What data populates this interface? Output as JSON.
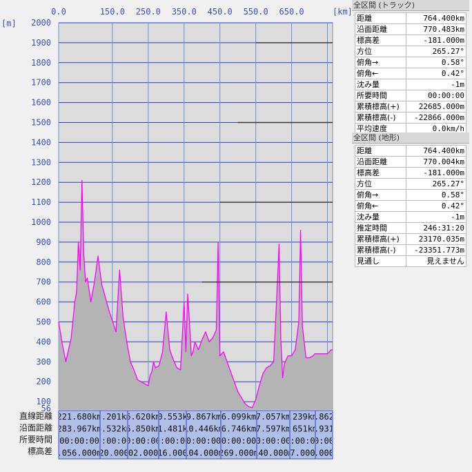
{
  "chart_data": {
    "type": "area",
    "xlabel": "",
    "ylabel": "",
    "x_unit": "[km]",
    "y_unit": "[m]",
    "x_ticks": [
      "0.0",
      "150.0",
      "250.0",
      "350.0",
      "450.0",
      "550.0",
      "650.0"
    ],
    "y_ticks": [
      "2000",
      "1900",
      "1800",
      "1700",
      "1600",
      "1500",
      "1400",
      "1300",
      "1200",
      "1100",
      "1000",
      "900",
      "800",
      "700",
      "600",
      "500",
      "400",
      "300",
      "200",
      "100",
      "56"
    ],
    "xlim": [
      0,
      764.4
    ],
    "ylim": [
      56,
      2000
    ],
    "series": [
      {
        "x": [
          0,
          10,
          20,
          35,
          45,
          50,
          55,
          60,
          65,
          70,
          75,
          80,
          90,
          100,
          110,
          120,
          140,
          160,
          170,
          180,
          190,
          200,
          210,
          220,
          230,
          240,
          250,
          255,
          260,
          265,
          270,
          280,
          290,
          300,
          310,
          320,
          330,
          340,
          350,
          355,
          360,
          365,
          370,
          375,
          380,
          390,
          400,
          410,
          420,
          430,
          440,
          445,
          450,
          455,
          460,
          470,
          480,
          500,
          510,
          520,
          530,
          540,
          550,
          560,
          570,
          580,
          590,
          600,
          610,
          615,
          620,
          625,
          630,
          635,
          640,
          650,
          660,
          670,
          675,
          680,
          690,
          700,
          710,
          715,
          720,
          730,
          740,
          750,
          760,
          764.4
        ],
        "y": [
          500,
          390,
          300,
          420,
          600,
          650,
          900,
          760,
          1210,
          840,
          700,
          720,
          600,
          700,
          830,
          690,
          560,
          450,
          760,
          520,
          400,
          300,
          260,
          210,
          200,
          190,
          180,
          230,
          250,
          300,
          270,
          280,
          350,
          550,
          360,
          310,
          270,
          260,
          600,
          350,
          640,
          500,
          330,
          350,
          400,
          360,
          410,
          450,
          400,
          420,
          460,
          900,
          330,
          340,
          350,
          300,
          250,
          150,
          120,
          90,
          75,
          70,
          110,
          180,
          240,
          270,
          280,
          300,
          680,
          890,
          410,
          220,
          290,
          310,
          330,
          330,
          360,
          500,
          960,
          480,
          320,
          320,
          330,
          340,
          340,
          340,
          340,
          340,
          360,
          360
        ]
      }
    ],
    "horizontal_marks": [
      {
        "y": 1900,
        "from": 550,
        "to": 764.4
      },
      {
        "y": 1500,
        "from": 500,
        "to": 764.4
      },
      {
        "y": 1100,
        "from": 450,
        "to": 764.4
      },
      {
        "y": 700,
        "from": 400,
        "to": 764.4
      }
    ],
    "colors": {
      "plot_bg": "#dcdcdc",
      "fill": "#b4b4b4",
      "line": "#ff00ff",
      "grid_h": "#2a3fbf",
      "grid_v": "#6c8fd8",
      "axis_text": "#3a4fc0",
      "table_bg": "#b0bfe8"
    }
  },
  "bottom_table": {
    "row_labels": [
      "直線距離",
      "沿面距離",
      "所要時間",
      "標高差"
    ],
    "rows": [
      [
        "221.680km",
        "6.201km",
        "6.620km",
        "10.553km",
        "9.867km",
        "6.099km",
        "7.057km",
        ".239km",
        ".862"
      ],
      [
        "283.967km",
        "6.532km",
        "6.850km",
        "11.481km",
        "10.446km",
        "6.746km",
        "7.597km",
        ".651km",
        ".931"
      ],
      [
        "00:00:00",
        "0:00:00",
        "0:00:00",
        "0:00:00",
        "0:00:00",
        "0:00:00",
        "0:00:00",
        "0:00:00",
        "0:00"
      ],
      [
        ".056.000m",
        "120.000m",
        "202.000m",
        "116.000m",
        "104.000m",
        "269.000m",
        "140.000m",
        "17.000m",
        ".000"
      ]
    ]
  },
  "panel_track": {
    "title": "全区間 (トラック)",
    "rows": [
      {
        "label": "距離",
        "value": "764.400km"
      },
      {
        "label": "沿面距離",
        "value": "770.483km"
      },
      {
        "label": "標高差",
        "value": "-181.000m"
      },
      {
        "label": "方位",
        "value": "265.27°"
      },
      {
        "label": "俯角→",
        "value": "0.58°"
      },
      {
        "label": "俯角←",
        "value": "0.42°"
      },
      {
        "label": "沈み量",
        "value": "-1m"
      },
      {
        "label": "所要時間",
        "value": "00:00:00"
      },
      {
        "label": "累積標高(+)",
        "value": "22685.000m"
      },
      {
        "label": "累積標高(-)",
        "value": "-22866.000m"
      },
      {
        "label": "平均速度",
        "value": "0.0km/h"
      }
    ]
  },
  "panel_terrain": {
    "title": "全区間 (地形)",
    "rows": [
      {
        "label": "距離",
        "value": "764.400km"
      },
      {
        "label": "沿面距離",
        "value": "770.004km"
      },
      {
        "label": "標高差",
        "value": "-181.000m"
      },
      {
        "label": "方位",
        "value": "265.27°"
      },
      {
        "label": "俯角→",
        "value": "0.58°"
      },
      {
        "label": "俯角←",
        "value": "0.42°"
      },
      {
        "label": "沈み量",
        "value": "-1m"
      },
      {
        "label": "推定時間",
        "value": "246:31:20"
      },
      {
        "label": "累積標高(+)",
        "value": "23170.035m"
      },
      {
        "label": "累積標高(-)",
        "value": "-23351.773m"
      },
      {
        "label": "見通し",
        "value": "見えません"
      }
    ]
  }
}
